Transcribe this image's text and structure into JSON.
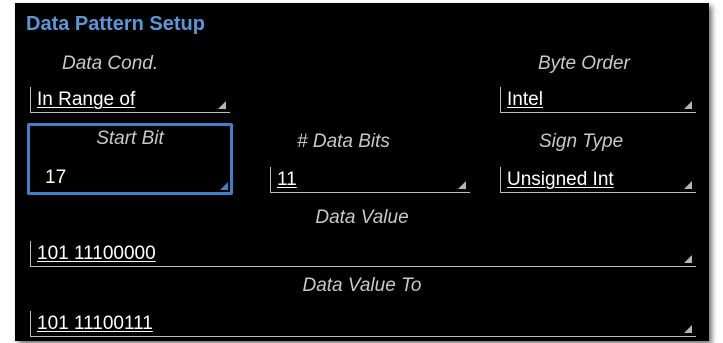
{
  "panel": {
    "title": "Data Pattern Setup"
  },
  "data_cond": {
    "label": "Data Cond.",
    "value": "In Range of"
  },
  "byte_order": {
    "label": "Byte Order",
    "value": "Intel"
  },
  "start_bit": {
    "label": "Start Bit",
    "value": "17"
  },
  "data_bits": {
    "label": "# Data Bits",
    "value": "11"
  },
  "sign_type": {
    "label": "Sign Type",
    "value": "Unsigned Int"
  },
  "data_value": {
    "label": "Data Value",
    "value": "101 11100000"
  },
  "data_value_to": {
    "label": "Data Value To",
    "value": "101 11100111"
  },
  "colors": {
    "title": "#5b97d8",
    "focus_border": "#3c82c8",
    "background": "#000000",
    "label": "#c8c8c8",
    "value": "#ffffff"
  },
  "icons": {
    "dropdown": "dropdown-triangle-icon"
  }
}
